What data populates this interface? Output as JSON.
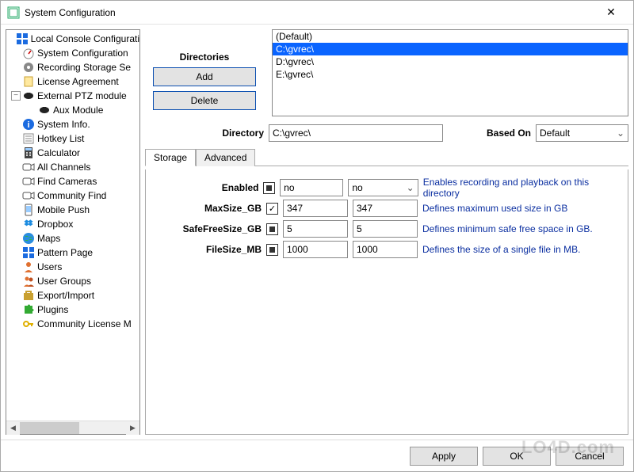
{
  "window": {
    "title": "System Configuration"
  },
  "tree": {
    "root": "Local Console Configurati",
    "items": [
      {
        "label": "System Configuration",
        "indent": 1,
        "icon": "gauge"
      },
      {
        "label": "Recording Storage Se",
        "indent": 1,
        "icon": "reel"
      },
      {
        "label": "License Agreement",
        "indent": 1,
        "icon": "scroll"
      },
      {
        "label": "External PTZ module",
        "indent": 1,
        "icon": "cam",
        "twisty": "−"
      },
      {
        "label": "Aux Module",
        "indent": 2,
        "icon": "cam"
      },
      {
        "label": "System Info.",
        "indent": 1,
        "icon": "info"
      },
      {
        "label": "Hotkey List",
        "indent": 1,
        "icon": "list"
      },
      {
        "label": "Calculator",
        "indent": 1,
        "icon": "calc"
      },
      {
        "label": "All Channels",
        "indent": 1,
        "icon": "camlight"
      },
      {
        "label": "Find Cameras",
        "indent": 1,
        "icon": "camlight"
      },
      {
        "label": "Community Find",
        "indent": 1,
        "icon": "camlight"
      },
      {
        "label": "Mobile Push",
        "indent": 1,
        "icon": "phone"
      },
      {
        "label": "Dropbox",
        "indent": 1,
        "icon": "dropbox"
      },
      {
        "label": "Maps",
        "indent": 1,
        "icon": "globe"
      },
      {
        "label": "Pattern Page",
        "indent": 1,
        "icon": "tiles"
      },
      {
        "label": "Users",
        "indent": 1,
        "icon": "user"
      },
      {
        "label": "User Groups",
        "indent": 1,
        "icon": "users"
      },
      {
        "label": "Export/Import",
        "indent": 1,
        "icon": "gearbox"
      },
      {
        "label": "Plugins",
        "indent": 1,
        "icon": "puzzle"
      },
      {
        "label": "Community License M",
        "indent": 1,
        "icon": "key"
      }
    ]
  },
  "directories": {
    "heading": "Directories",
    "add": "Add",
    "delete": "Delete",
    "list": [
      "(Default)",
      "C:\\gvrec\\",
      "D:\\gvrec\\",
      "E:\\gvrec\\"
    ],
    "selected_index": 1
  },
  "directory_field": {
    "label": "Directory",
    "value": "C:\\gvrec\\"
  },
  "based_on": {
    "label": "Based On",
    "value": "Default"
  },
  "tabs": {
    "storage": "Storage",
    "advanced": "Advanced",
    "active": 0
  },
  "storage_rows": [
    {
      "name": "Enabled",
      "check": "square",
      "v1": "no",
      "v2": "no",
      "v2_is_select": true,
      "desc": "Enables recording and playback on this directory"
    },
    {
      "name": "MaxSize_GB",
      "check": "check",
      "v1": "347",
      "v2": "347",
      "desc": "Defines maximum used size in GB"
    },
    {
      "name": "SafeFreeSize_GB",
      "check": "square",
      "v1": "5",
      "v2": "5",
      "desc": "Defines minimum safe free space in GB."
    },
    {
      "name": "FileSize_MB",
      "check": "square",
      "v1": "1000",
      "v2": "1000",
      "desc": "Defines the size of a single file in MB."
    }
  ],
  "buttons": {
    "apply": "Apply",
    "ok": "OK",
    "cancel": "Cancel"
  },
  "watermark": "LO4D.com"
}
